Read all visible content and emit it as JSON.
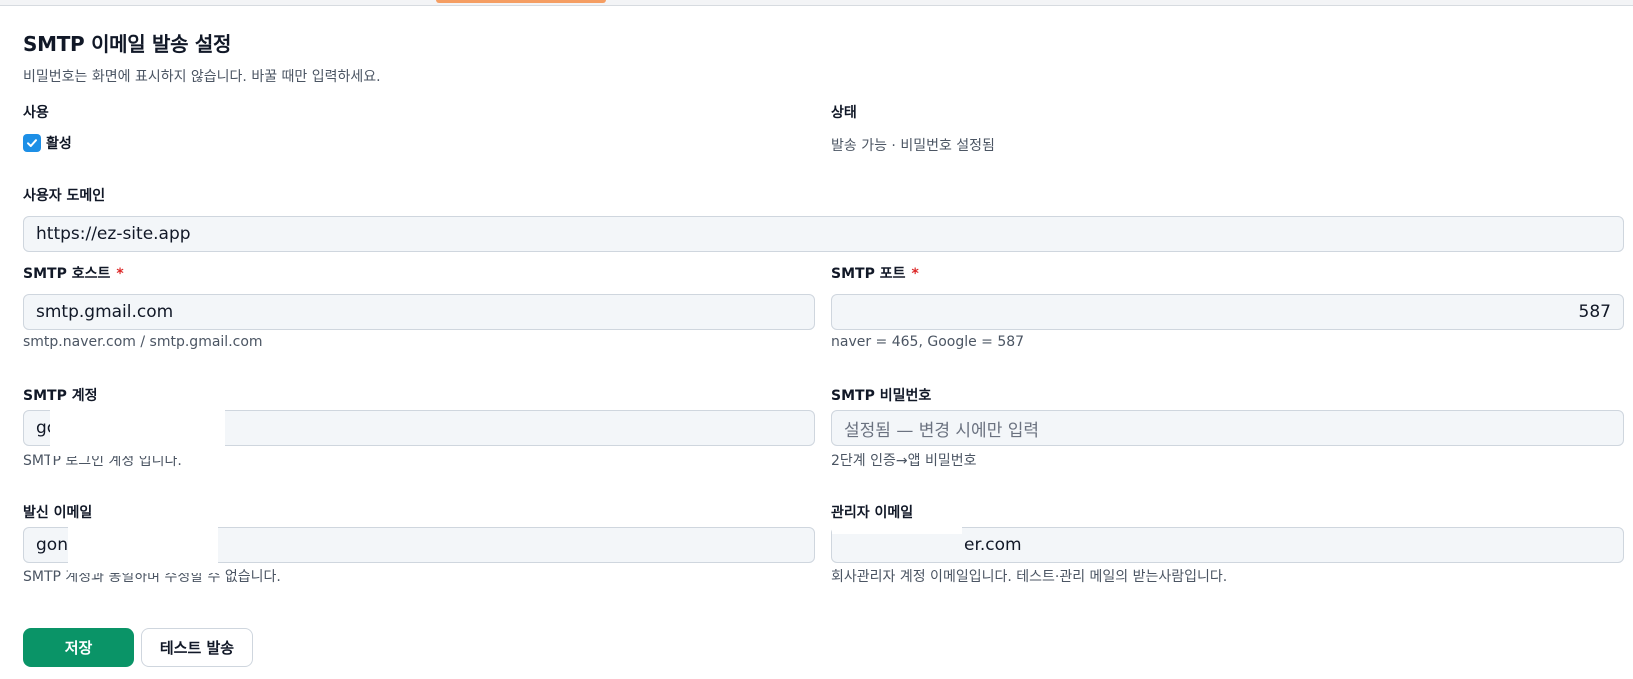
{
  "page": {
    "title": "SMTP 이메일 발송 설정",
    "description": "비밀번호는 화면에 표시하지 않습니다. 바꿀 때만 입력하세요."
  },
  "usage": {
    "label": "사용",
    "checkbox_label": "활성",
    "checked": true
  },
  "status": {
    "label": "상태",
    "value": "발송 가능 · 비밀번호 설정됨"
  },
  "domain": {
    "label": "사용자 도메인",
    "value": "https://ez-site.app"
  },
  "host": {
    "label": "SMTP 호스트",
    "required_mark": "*",
    "value": "smtp.gmail.com",
    "help": "smtp.naver.com / smtp.gmail.com"
  },
  "port": {
    "label": "SMTP 포트",
    "required_mark": "*",
    "value": "587",
    "help": "naver = 465, Google = 587"
  },
  "account": {
    "label": "SMTP 계정",
    "value": "gc",
    "help": "SMTP 로그인 계정 입니다."
  },
  "password": {
    "label": "SMTP 비밀번호",
    "placeholder": "설정됨 — 변경 시에만 입력",
    "help": "2단계 인증→앱 비밀번호"
  },
  "sender": {
    "label": "발신 이메일",
    "value": "gon",
    "help": "SMTP 계정과 동일하며 수정할 수 없습니다."
  },
  "admin": {
    "label": "관리자 이메일",
    "value": "er.com",
    "help": "회사관리자 계정 이메일입니다. 테스트·관리 메일의 받는사람입니다."
  },
  "actions": {
    "save": "저장",
    "test_send": "테스트 발송"
  },
  "colors": {
    "primary": "#0a9467",
    "checkbox": "#1d8fe6",
    "required": "#dc2626"
  }
}
